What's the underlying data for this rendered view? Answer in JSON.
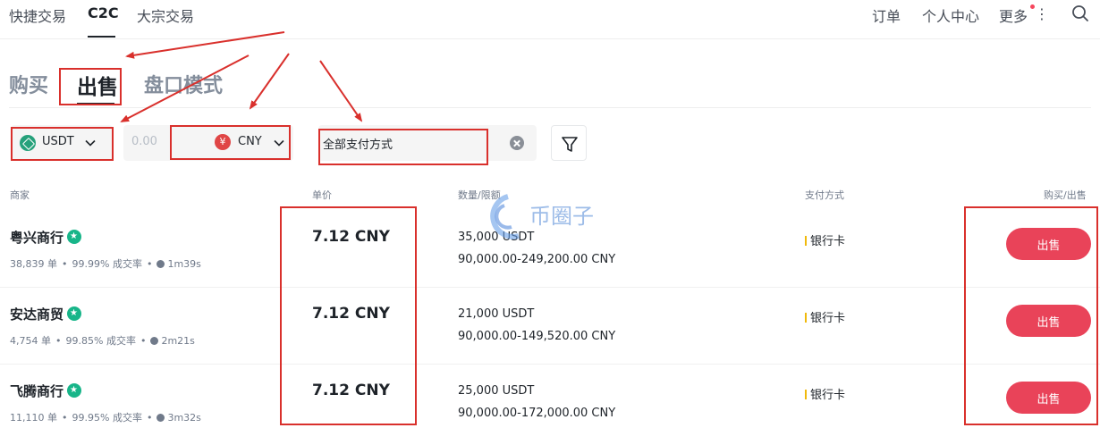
{
  "nav": {
    "items": [
      "快捷交易",
      "C2C",
      "大宗交易"
    ],
    "active": "C2C",
    "right": [
      "订单",
      "个人中心",
      "更多"
    ]
  },
  "mode_tabs": [
    "购买",
    "出售",
    "盘口模式"
  ],
  "mode_active": "出售",
  "filters": {
    "coin": "USDT",
    "amount_placeholder": "0.00",
    "currency": "CNY",
    "currency_symbol": "¥",
    "payment": "全部支付方式"
  },
  "table": {
    "headers": [
      "商家",
      "单价",
      "数量/限额",
      "支付方式",
      "购买/出售"
    ],
    "rows": [
      {
        "merchant": "粤兴商行",
        "orders": "38,839 单",
        "rate": "99.99% 成交率",
        "time": "1m39s",
        "price": "7.12 CNY",
        "qty": "35,000 USDT",
        "limit": "90,000.00-249,200.00 CNY",
        "payment": "银行卡",
        "action": "出售"
      },
      {
        "merchant": "安达商贸",
        "orders": "4,754 单",
        "rate": "99.85% 成交率",
        "time": "2m21s",
        "price": "7.12 CNY",
        "qty": "21,000 USDT",
        "limit": "90,000.00-149,520.00 CNY",
        "payment": "银行卡",
        "action": "出售"
      },
      {
        "merchant": "飞腾商行",
        "orders": "11,110 单",
        "rate": "99.95% 成交率",
        "time": "3m32s",
        "price": "7.12 CNY",
        "qty": "25,000 USDT",
        "limit": "90,000.00-172,000.00 CNY",
        "payment": "银行卡",
        "action": "出售"
      }
    ]
  },
  "watermark": "币圈子",
  "colors": {
    "sell_button": "#e94359",
    "annotation": "#d9302c",
    "verified": "#18b589",
    "usdt": "#26a17b"
  }
}
